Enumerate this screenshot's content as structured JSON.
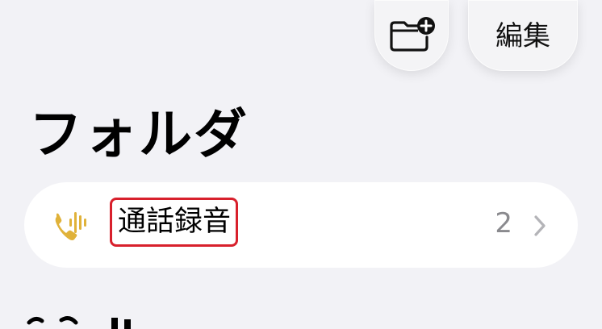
{
  "toolbar": {
    "new_folder_icon": "folder-plus-icon",
    "edit_label": "編集"
  },
  "page": {
    "title": "フォルダ"
  },
  "folders": [
    {
      "name": "通話録音",
      "count": "2",
      "icon": "phone-waveform-icon",
      "icon_color": "#e0b23a",
      "highlight_color": "#d8202c"
    }
  ],
  "colors": {
    "background": "#f2f2f6",
    "row_background": "#ffffff",
    "secondary_text": "#8a8a8e"
  }
}
